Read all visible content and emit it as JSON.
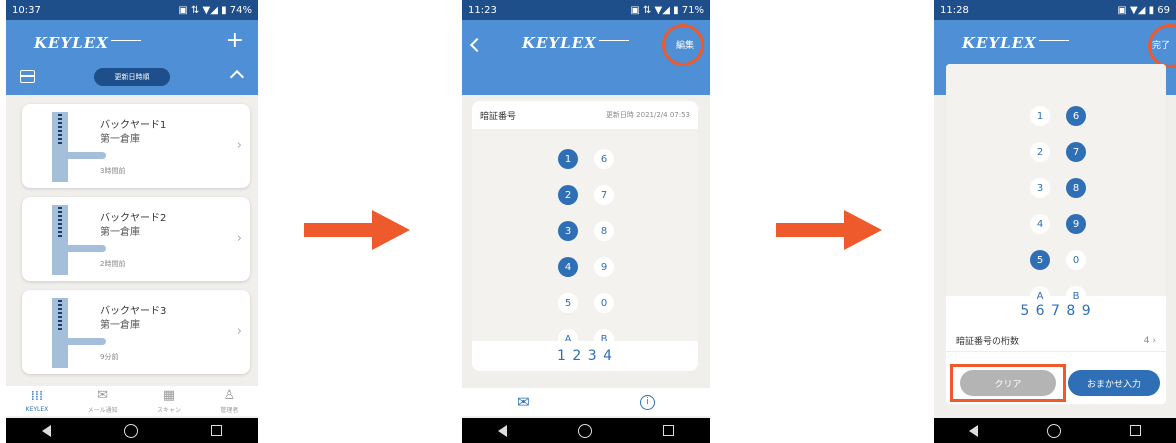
{
  "colors": {
    "accent": "#4f8fd6",
    "dark_accent": "#1e4f8a",
    "key_on": "#2f6fb6",
    "highlight": "#ee5a2c"
  },
  "screen1": {
    "status": {
      "time": "10:37",
      "right": "▣ ⇅ ▼◢ ▮ 74%"
    },
    "logo": "KEYLEX",
    "add_icon": "+",
    "sort_label": "更新日時順",
    "cards": [
      {
        "name": "バックヤード1",
        "location": "第一倉庫",
        "time": "3時間前"
      },
      {
        "name": "バックヤード2",
        "location": "第一倉庫",
        "time": "2時間前"
      },
      {
        "name": "バックヤード3",
        "location": "第一倉庫",
        "time": "9分前"
      }
    ],
    "tabs": [
      {
        "icon": "dots-grid-icon",
        "label": "KEYLEX"
      },
      {
        "icon": "mail-icon",
        "label": "メール通知"
      },
      {
        "icon": "qr-icon",
        "label": "スキャン"
      },
      {
        "icon": "person-icon",
        "label": "管理者"
      }
    ]
  },
  "screen2": {
    "status": {
      "time": "11:23",
      "right": "▣ ⇅ ▼◢ ▮ 71%"
    },
    "logo": "KEYLEX",
    "edit_label": "編集",
    "card_title": "暗証番号",
    "updated": "更新日時 2021/2/4 07:53",
    "keys": [
      [
        "1",
        "6"
      ],
      [
        "2",
        "7"
      ],
      [
        "3",
        "8"
      ],
      [
        "4",
        "9"
      ],
      [
        "5",
        "0"
      ],
      [
        "A",
        "B"
      ]
    ],
    "code": "1 2 3 4"
  },
  "screen3": {
    "status": {
      "time": "11:28",
      "right": "▣ ▼◢ ▮ 69"
    },
    "logo": "KEYLEX",
    "done_label": "完了",
    "keys": [
      [
        "1",
        "6"
      ],
      [
        "2",
        "7"
      ],
      [
        "3",
        "8"
      ],
      [
        "4",
        "9"
      ],
      [
        "5",
        "0"
      ],
      [
        "A",
        "B"
      ]
    ],
    "code": "5 6 7 8 9",
    "digits_label": "暗証番号の桁数",
    "digits_value": "4",
    "clear_label": "クリア",
    "auto_label": "おまかせ入力"
  }
}
